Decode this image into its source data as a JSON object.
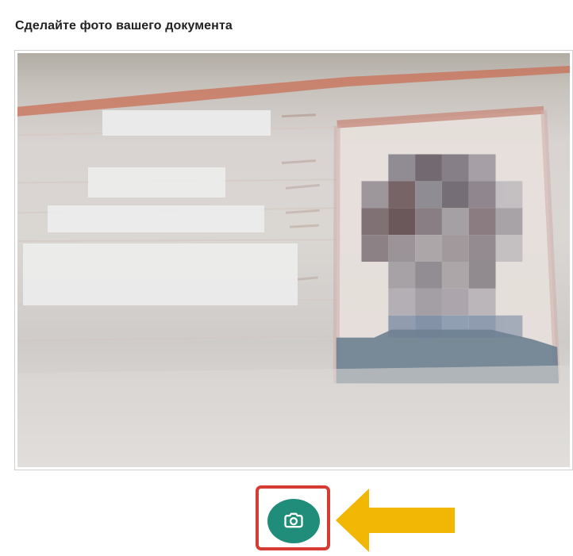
{
  "header": {
    "title": "Сделайте фото вашего документа"
  },
  "capture": {
    "icon": "camera-icon",
    "button_color": "#1f8d79",
    "highlight_color": "#d63b34",
    "arrow_color": "#f2b705",
    "arrow_icon": "arrow-left-icon"
  }
}
